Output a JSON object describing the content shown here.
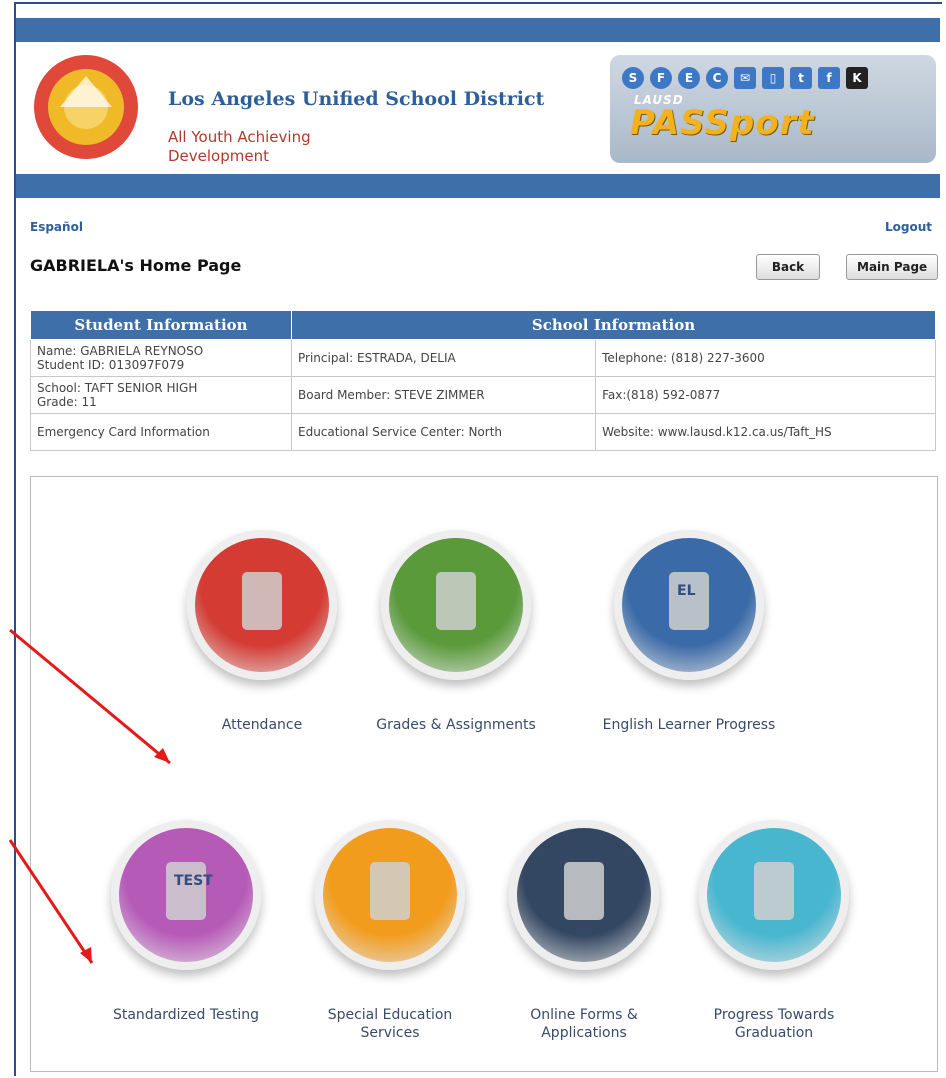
{
  "header": {
    "org_name": "Los Angeles Unified School District",
    "tagline": "All Youth Achieving Development",
    "passport_small": "LAUSD",
    "passport_logo": "PASSport",
    "passport_icons": [
      "S",
      "F",
      "E",
      "C",
      "mail-icon",
      "ipad-icon",
      "twitter-icon",
      "facebook-icon",
      "k-icon"
    ]
  },
  "nav": {
    "language": "Español",
    "logout": "Logout"
  },
  "page": {
    "title": "GABRIELA's Home Page",
    "back": "Back",
    "main_page": "Main Page"
  },
  "table": {
    "headers": [
      "Student Information",
      "School Information"
    ],
    "rows": [
      [
        "Name: GABRIELA REYNOSO\nStudent ID: 013097F079",
        "Principal: ESTRADA, DELIA",
        "Telephone: (818) 227-3600"
      ],
      [
        "School: TAFT SENIOR HIGH\nGrade: 11",
        "Board Member: STEVE ZIMMER",
        "Fax:(818) 592-0877"
      ],
      [
        "Emergency Card Information",
        "Educational Service Center: North",
        "Website: www.lausd.k12.ca.us/Taft_HS"
      ]
    ]
  },
  "tiles": [
    {
      "label": "Attendance",
      "color": "#d33b33",
      "icon": "person-raising-hand-icon"
    },
    {
      "label": "Grades & Assignments",
      "color": "#5a9a3b",
      "icon": "graded-paper-icon"
    },
    {
      "label": "English Learner Progress",
      "color": "#3a6aa7",
      "icon": "el-book-icon",
      "badge": "EL"
    },
    {
      "label": "Standardized Testing",
      "color": "#b65ab8",
      "icon": "test-tablet-icon",
      "badge": "TEST"
    },
    {
      "label": "Special Education Services",
      "color": "#f29c1e",
      "icon": "puzzle-icon"
    },
    {
      "label": "Online Forms & Applications",
      "color": "#334762",
      "icon": "forms-computer-icon"
    },
    {
      "label": "Progress Towards Graduation",
      "color": "#49b6d0",
      "icon": "graduate-icon"
    }
  ]
}
